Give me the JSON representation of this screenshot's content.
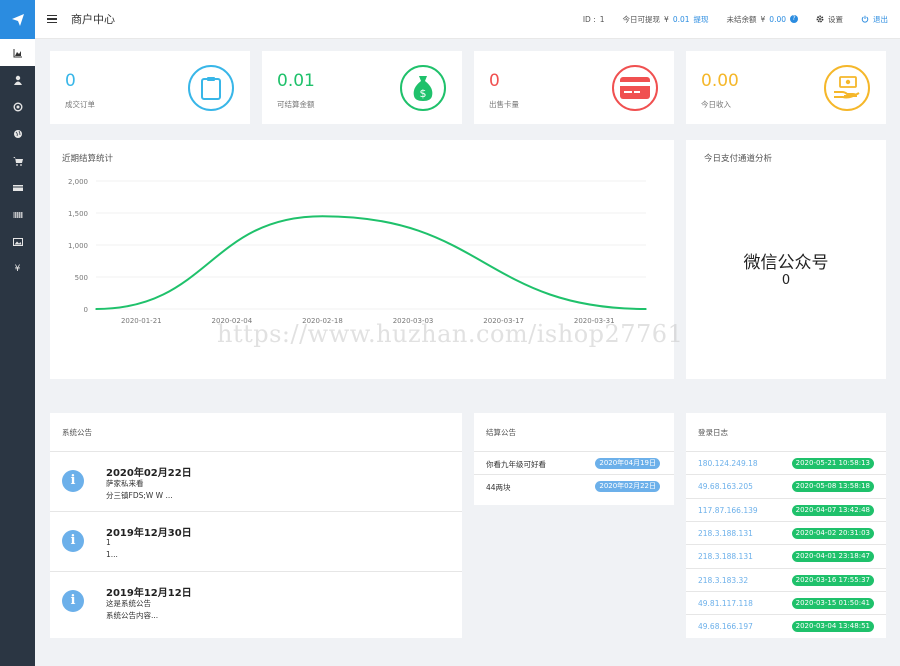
{
  "header": {
    "title": "商户中心",
    "id_label": "ID :",
    "id_value": "1",
    "withdraw_label": "今日可提现",
    "withdraw_currency": "¥",
    "withdraw_amount": "0.01",
    "withdraw_link": "提现",
    "unsettled_label": "未结余额",
    "unsettled_currency": "¥",
    "unsettled_amount": "0.00",
    "unsettled_help": "?",
    "settings_label": "设置",
    "logout_label": "退出"
  },
  "sidebar": {
    "items": [
      {
        "icon": "area-chart-icon"
      },
      {
        "icon": "user-icon"
      },
      {
        "icon": "support-icon"
      },
      {
        "icon": "globe-icon"
      },
      {
        "icon": "cart-icon"
      },
      {
        "icon": "card-icon"
      },
      {
        "icon": "barcode-icon"
      },
      {
        "icon": "image-icon"
      },
      {
        "icon": "yen-icon",
        "glyph": "¥"
      }
    ]
  },
  "stats": [
    {
      "value": "0",
      "label": "成交订单",
      "color": "#38b6e8",
      "icon": "clipboard-icon"
    },
    {
      "value": "0.01",
      "label": "可结算金额",
      "color": "#1fc16b",
      "icon": "money-bag-icon"
    },
    {
      "value": "0",
      "label": "出售卡量",
      "color": "#f05050",
      "icon": "credit-card-icon"
    },
    {
      "value": "0.00",
      "label": "今日收入",
      "color": "#f5b72a",
      "icon": "cash-hand-icon"
    }
  ],
  "chart_panel": {
    "title": "近期结算统计"
  },
  "chart_data": {
    "type": "line",
    "title": "近期结算统计",
    "x": [
      "2020-01-14",
      "2020-02-18",
      "2020-04-08"
    ],
    "x_tick_labels": [
      "2020-01-21",
      "2020-02-04",
      "2020-02-18",
      "2020-03-03",
      "2020-03-17",
      "2020-03-31"
    ],
    "y_tick_labels": [
      "2,000",
      "1,500",
      "1,000",
      "500",
      "0"
    ],
    "ylim": [
      0,
      2000
    ],
    "series": [
      {
        "values": [
          0,
          1450,
          0
        ]
      }
    ],
    "color": "#1fc16b"
  },
  "channel_panel": {
    "title": "今日支付通道分析",
    "channel": "微信公众号",
    "value": "0"
  },
  "watermark": "https://www.huzhan.com/ishop27761",
  "announcements": {
    "title": "系统公告",
    "items": [
      {
        "date": "2020年02月22日",
        "line1": "萨家私来看",
        "line2": "分三镇FDS;W W   ..."
      },
      {
        "date": "2019年12月30日",
        "line1": "1",
        "line2": "1..."
      },
      {
        "date": "2019年12月12日",
        "line1": "这是系统公告",
        "line2": "系统公告内容..."
      }
    ]
  },
  "settlements": {
    "title": "结算公告",
    "items": [
      {
        "text": "你看九年级可好看",
        "date": "2020年04月19日"
      },
      {
        "text": "44两块",
        "date": "2020年02月22日"
      }
    ]
  },
  "login_log": {
    "title": "登录日志",
    "items": [
      {
        "ip": "180.124.249.18",
        "time": "2020-05-21 10:58:13"
      },
      {
        "ip": "49.68.163.205",
        "time": "2020-05-08 13:58:18"
      },
      {
        "ip": "117.87.166.139",
        "time": "2020-04-07 13:42:48"
      },
      {
        "ip": "218.3.188.131",
        "time": "2020-04-02 20:31:03"
      },
      {
        "ip": "218.3.188.131",
        "time": "2020-04-01 23:18:47"
      },
      {
        "ip": "218.3.183.32",
        "time": "2020-03-16 17:55:37"
      },
      {
        "ip": "49.81.117.118",
        "time": "2020-03-15 01:50:41"
      },
      {
        "ip": "49.68.166.197",
        "time": "2020-03-04 13:48:51"
      }
    ]
  }
}
